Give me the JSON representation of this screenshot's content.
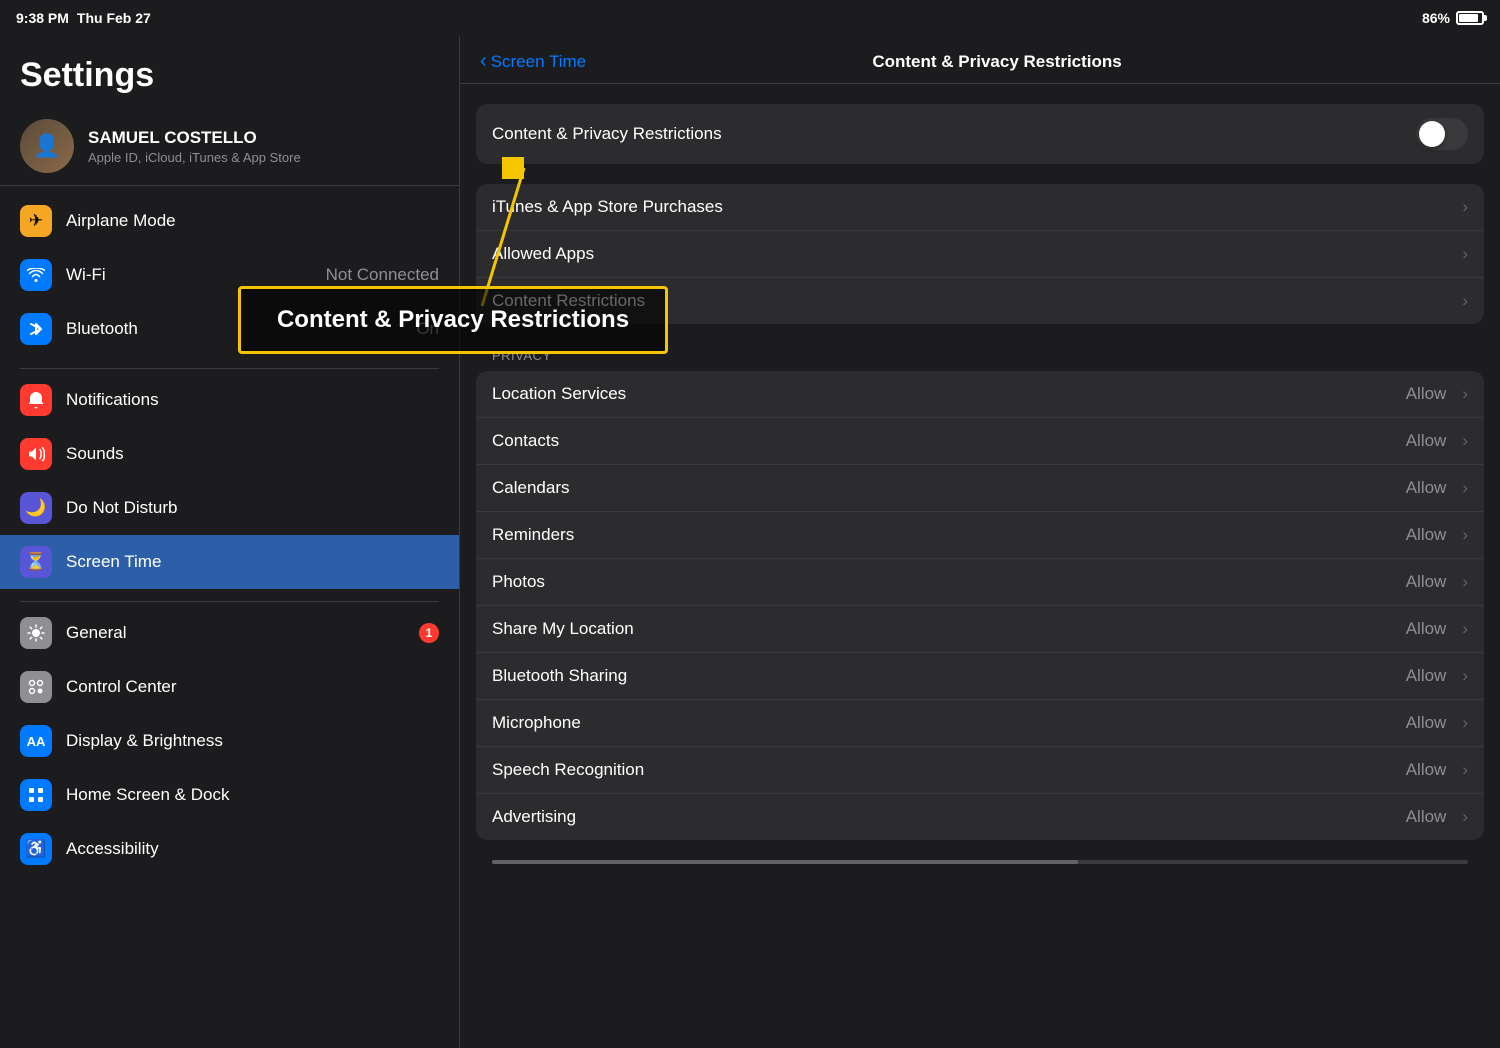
{
  "statusBar": {
    "time": "9:38 PM",
    "date": "Thu Feb 27",
    "battery": "86%"
  },
  "sidebar": {
    "title": "Settings",
    "account": {
      "name": "SAMUEL COSTELLO",
      "sub": "Apple ID, iCloud, iTunes & App Store"
    },
    "sections": [
      {
        "items": [
          {
            "id": "airplane-mode",
            "label": "Airplane Mode",
            "value": "",
            "iconBg": "#f5a623",
            "iconChar": "✈"
          },
          {
            "id": "wifi",
            "label": "Wi-Fi",
            "value": "Not Connected",
            "iconBg": "#007aff",
            "iconChar": "📶"
          },
          {
            "id": "bluetooth",
            "label": "Bluetooth",
            "value": "On",
            "iconBg": "#007aff",
            "iconChar": "⊕"
          }
        ]
      },
      {
        "items": [
          {
            "id": "notifications",
            "label": "Notifications",
            "value": "",
            "iconBg": "#ff3b30",
            "iconChar": "🔔"
          },
          {
            "id": "sounds",
            "label": "Sounds",
            "value": "",
            "iconBg": "#ff3b30",
            "iconChar": "🔊"
          },
          {
            "id": "do-not-disturb",
            "label": "Do Not Disturb",
            "value": "",
            "iconBg": "#5856d6",
            "iconChar": "🌙"
          },
          {
            "id": "screen-time",
            "label": "Screen Time",
            "value": "",
            "iconBg": "#5856d6",
            "iconChar": "⏳",
            "active": true
          }
        ]
      },
      {
        "items": [
          {
            "id": "general",
            "label": "General",
            "value": "",
            "badge": "1",
            "iconBg": "#8e8e93",
            "iconChar": "⚙"
          },
          {
            "id": "control-center",
            "label": "Control Center",
            "value": "",
            "iconBg": "#8e8e93",
            "iconChar": "⊞"
          },
          {
            "id": "display-brightness",
            "label": "Display & Brightness",
            "value": "",
            "iconBg": "#007aff",
            "iconChar": "AA"
          },
          {
            "id": "home-screen-dock",
            "label": "Home Screen & Dock",
            "value": "",
            "iconBg": "#007aff",
            "iconChar": "⋮⋮"
          },
          {
            "id": "accessibility",
            "label": "Accessibility",
            "value": "",
            "iconBg": "#007aff",
            "iconChar": "♿"
          }
        ]
      }
    ]
  },
  "detail": {
    "backLabel": "Screen Time",
    "title": "Content & Privacy Restrictions",
    "toggle": {
      "label": "Content & Privacy Restrictions",
      "on": false
    },
    "groups": [
      {
        "items": [
          {
            "id": "itunes-purchases",
            "label": "iTunes & App Store Purchases",
            "value": ""
          },
          {
            "id": "allowed-apps",
            "label": "Allowed Apps",
            "value": ""
          },
          {
            "id": "content-restrictions",
            "label": "Content Restrictions",
            "value": ""
          }
        ]
      },
      {
        "sectionLabel": "PRIVACY",
        "items": [
          {
            "id": "location-services",
            "label": "Location Services",
            "value": "Allow"
          },
          {
            "id": "contacts",
            "label": "Contacts",
            "value": "Allow"
          },
          {
            "id": "calendars",
            "label": "Calendars",
            "value": "Allow"
          },
          {
            "id": "reminders",
            "label": "Reminders",
            "value": "Allow"
          },
          {
            "id": "photos",
            "label": "Photos",
            "value": "Allow"
          },
          {
            "id": "share-my-location",
            "label": "Share My Location",
            "value": "Allow"
          },
          {
            "id": "bluetooth-sharing",
            "label": "Bluetooth Sharing",
            "value": "Allow"
          },
          {
            "id": "microphone",
            "label": "Microphone",
            "value": "Allow"
          },
          {
            "id": "speech-recognition",
            "label": "Speech Recognition",
            "value": "Allow"
          },
          {
            "id": "advertising",
            "label": "Advertising",
            "value": "Allow"
          }
        ]
      }
    ]
  },
  "annotation": {
    "boxText": "Content & Privacy Restrictions"
  }
}
